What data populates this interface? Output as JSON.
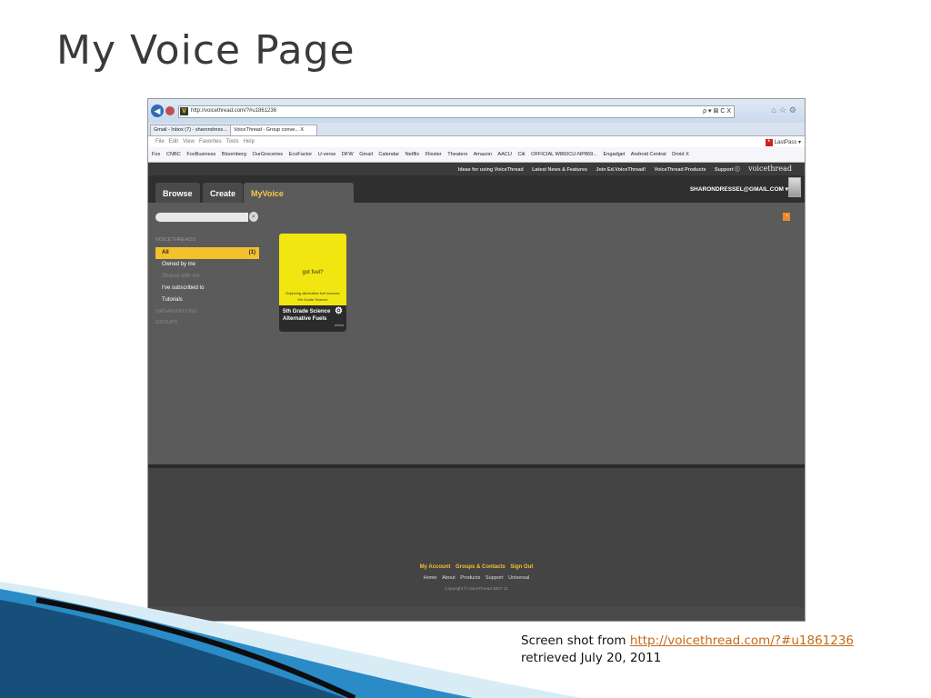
{
  "slide": {
    "title": "My Voice Page",
    "caption_prefix": "Screen shot from ",
    "caption_link": "http://voicethread.com/?#u1861236",
    "caption_line2": "retrieved July 20, 2011"
  },
  "browser": {
    "url": "http://voicethread.com/?#u1861236",
    "address_controls": "ρ ▾ ⊠ C X",
    "tabs": [
      "Gmail - Inbox (7) - sharondress...",
      "VoiceThread - Group conve... X"
    ],
    "menu": [
      "File",
      "Edit",
      "View",
      "Favorites",
      "Tools",
      "Help"
    ],
    "lastpass": "LastPass ▾",
    "favorites": [
      "Fox",
      "CNBC",
      "FoxBusiness",
      "Bloomberg",
      "OurGroceries",
      "EcoFactor",
      "U-verse",
      "DFW",
      "Gmail",
      "Calendar",
      "Netflix",
      "Flixster",
      "Theaters",
      "Amazon",
      "AACU",
      "Citi",
      "OFFICIAL W860CU-NP869...",
      "Engadget",
      "Android Central",
      "Droid X"
    ]
  },
  "vt": {
    "top_links": [
      "Ideas for using VoiceThread",
      "Latest News & Features",
      "Join Ed.VoiceThread!",
      "VoiceThread Products",
      "Support ⓘ"
    ],
    "logo": "voicethread",
    "nav": {
      "browse": "Browse",
      "create": "Create",
      "myvoice": "MyVoice"
    },
    "user": "SHARONDRESSEL@GMAIL.COM ▾",
    "sidebar": {
      "heading": "VOICETHREADS",
      "all": "All",
      "all_count": "(1)",
      "owned": "Owned by me",
      "shared": "Shared with me",
      "subscribed": "I've subscribed to",
      "tutorials": "Tutorials",
      "organizations": "ORGANIZATIONS",
      "groups": "GROUPS"
    },
    "card": {
      "headline": "got fuel?",
      "sub1": "Exploring alternative fuel sources",
      "sub2": "5th Grade Science",
      "title1": "5th Grade Science",
      "title2": "Alternative Fuels",
      "menu": "menu"
    },
    "footer": {
      "links1": [
        "My Account",
        "Groups & Contacts",
        "Sign Out"
      ],
      "links2": [
        "Home",
        "About",
        "Products",
        "Support",
        "Universal"
      ],
      "copyright": "Copyright © VoiceThread 2007-11"
    }
  },
  "colors": {
    "accent_yellow": "#f3c12d",
    "card_yellow": "#f2e611",
    "link": "#c36a1a"
  }
}
